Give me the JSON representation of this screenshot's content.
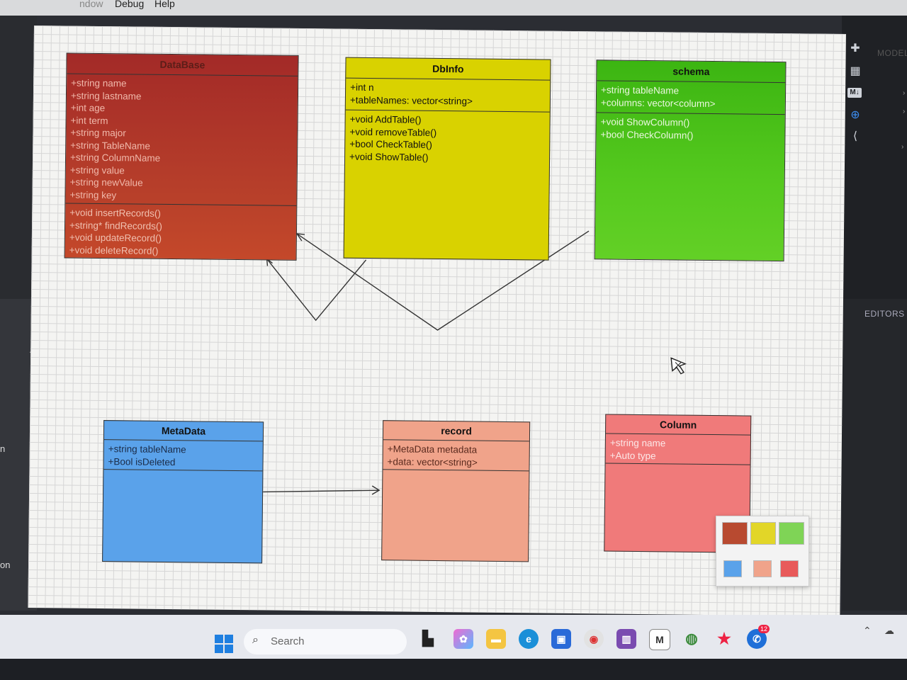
{
  "menu": {
    "window": "ndow",
    "debug": "Debug",
    "help": "Help"
  },
  "left": {
    "label1": "n",
    "label2": "on"
  },
  "right_panel": {
    "model_label": "MODEL",
    "editors_label": "EDITORS",
    "md_badge": "M↓"
  },
  "classes": {
    "database": {
      "name": "DataBase",
      "attributes": [
        "+string name",
        "+string lastname",
        "+int age",
        "+int term",
        "+string major",
        "+string TableName",
        "+string ColumnName",
        "+string value",
        "+string newValue",
        "+string key"
      ],
      "methods": [
        "+void insertRecords()",
        "+string* findRecords()",
        "+void updateRecord()",
        "+void deleteRecord()"
      ],
      "color": "#b0352a"
    },
    "dbinfo": {
      "name": "DbInfo",
      "attributes": [
        "+int n",
        "+tableNames: vector<string>"
      ],
      "methods": [
        "+void AddTable()",
        "+void removeTable()",
        "+bool CheckTable()",
        "+void ShowTable()"
      ],
      "color": "#dcd400"
    },
    "schema": {
      "name": "schema",
      "attributes": [
        "+string tableName",
        "+columns: vector<column>"
      ],
      "methods": [
        "+void ShowColumn()",
        "+bool CheckColumn()"
      ],
      "color": "#4fc918"
    },
    "metadata": {
      "name": "MetaData",
      "attributes": [
        "+string tableName",
        "+Bool isDeleted"
      ],
      "color": "#5a9fe8"
    },
    "record": {
      "name": "record",
      "attributes": [
        "+MetaData metadata",
        "+data: vector<string>"
      ],
      "color": "#f0a088"
    },
    "column": {
      "name": "Column",
      "attributes": [
        "+string name",
        "+Auto  type"
      ],
      "color": "#f07878"
    }
  },
  "taskbar": {
    "search_placeholder": "Search",
    "badge": "12"
  }
}
